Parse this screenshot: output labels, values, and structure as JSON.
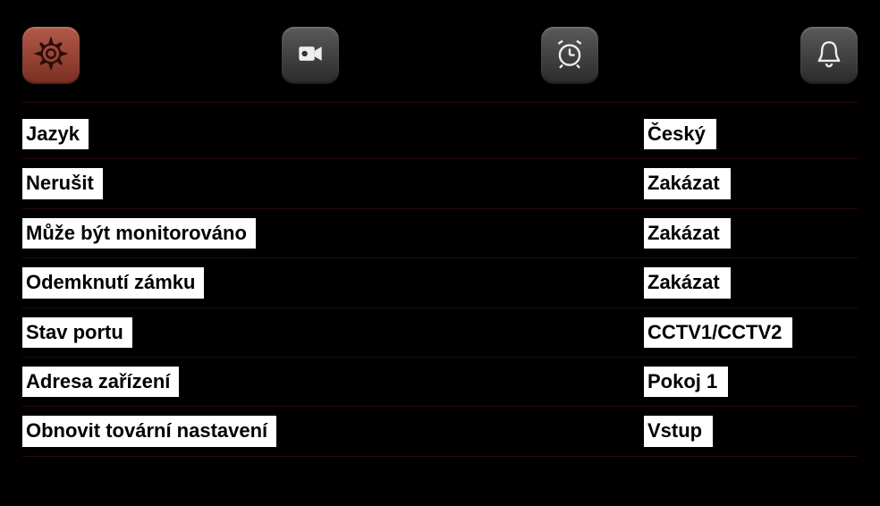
{
  "tabs": {
    "settings": "settings",
    "camera": "camera",
    "alarm_clock": "alarm-clock",
    "bell": "bell"
  },
  "rows": [
    {
      "label": "Jazyk",
      "value": "Český"
    },
    {
      "label": "Nerušit",
      "value": "Zakázat"
    },
    {
      "label": "Může být monitorováno",
      "value": "Zakázat"
    },
    {
      "label": "Odemknutí zámku",
      "value": "Zakázat"
    },
    {
      "label": "Stav portu",
      "value": "CCTV1/CCTV2"
    },
    {
      "label": "Adresa zařízení",
      "value": "Pokoj 1"
    },
    {
      "label": "Obnovit tovární nastavení",
      "value": "Vstup"
    }
  ]
}
